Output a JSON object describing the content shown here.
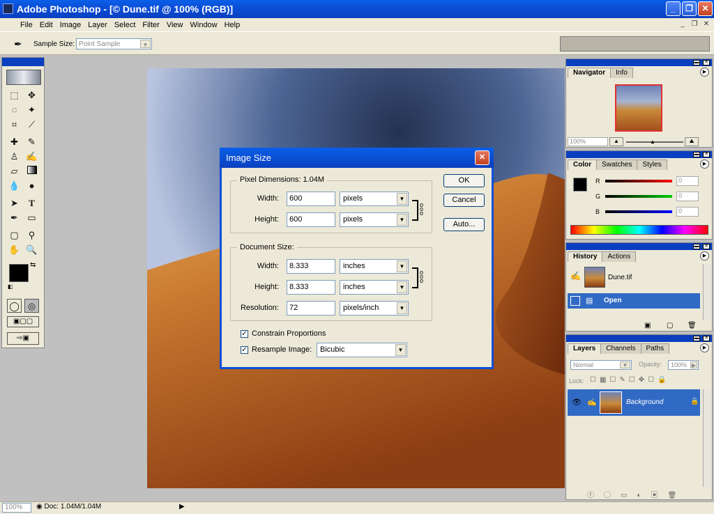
{
  "window": {
    "title": "Adobe Photoshop - [© Dune.tif @ 100% (RGB)]"
  },
  "menu": {
    "items": [
      "File",
      "Edit",
      "Image",
      "Layer",
      "Select",
      "Filter",
      "View",
      "Window",
      "Help"
    ]
  },
  "options": {
    "sample_label": "Sample Size:",
    "sample_value": "Point Sample"
  },
  "navigator": {
    "tabs": [
      "Navigator",
      "Info"
    ],
    "zoom": "100%"
  },
  "color": {
    "tabs": [
      "Color",
      "Swatches",
      "Styles"
    ],
    "r_label": "R",
    "g_label": "G",
    "b_label": "B",
    "r_value": "0",
    "g_value": "0",
    "b_value": "0"
  },
  "history": {
    "tabs": [
      "History",
      "Actions"
    ],
    "snapshot": "Dune.tif",
    "step": "Open"
  },
  "layers": {
    "tabs": [
      "Layers",
      "Channels",
      "Paths"
    ],
    "blend": "Normal",
    "opacity_label": "Opacity:",
    "opacity": "100%",
    "lock_label": "Lock:",
    "layer_name": "Background"
  },
  "status": {
    "zoom": "100%",
    "doc": "Doc: 1.04M/1.04M"
  },
  "dialog": {
    "title": "Image Size",
    "pixel_dimensions": "Pixel Dimensions:  1.04M",
    "px_width_label": "Width:",
    "px_width": "600",
    "px_width_unit": "pixels",
    "px_height_label": "Height:",
    "px_height": "600",
    "px_height_unit": "pixels",
    "document_size": "Document Size:",
    "doc_width_label": "Width:",
    "doc_width": "8.333",
    "doc_width_unit": "inches",
    "doc_height_label": "Height:",
    "doc_height": "8.333",
    "doc_height_unit": "inches",
    "resolution_label": "Resolution:",
    "resolution": "72",
    "resolution_unit": "pixels/inch",
    "constrain": "Constrain Proportions",
    "resample": "Resample Image:",
    "resample_method": "Bicubic",
    "ok": "OK",
    "cancel": "Cancel",
    "auto": "Auto..."
  },
  "colors": {
    "accent": "#0a4fd8",
    "dialog_bg": "#ece9d8"
  }
}
